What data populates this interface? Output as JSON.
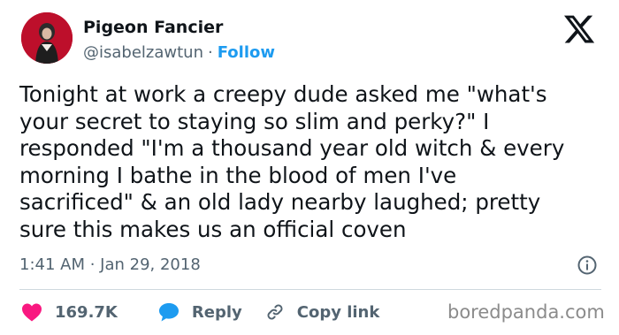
{
  "author": {
    "name": "Pigeon Fancier",
    "handle": "@isabelzawtun",
    "separator": "·",
    "follow_label": "Follow"
  },
  "tweet": {
    "text": "Tonight at work a creepy dude asked me \"what's\nyour secret to staying so slim and perky?\" I\nresponded \"I'm a thousand year old witch & every\nmorning I bathe in the blood of men I've\nsacrificed\" & an old lady nearby laughed; pretty\nsure this makes us an official coven",
    "timestamp": "1:41 AM · Jan 29, 2018"
  },
  "actions": {
    "like_count": "169.7K",
    "reply_label": "Reply",
    "copy_link_label": "Copy link"
  },
  "watermark": "boredpanda.com",
  "icons": {
    "platform_logo": "x-logo",
    "info": "info-icon",
    "like": "heart-icon",
    "reply": "speech-bubble-icon",
    "copy_link": "link-icon"
  },
  "colors": {
    "text": "#0f1419",
    "secondary_text": "#536471",
    "accent": "#1d9bf0",
    "like": "#f91880",
    "avatar_background": "#c8102e"
  }
}
